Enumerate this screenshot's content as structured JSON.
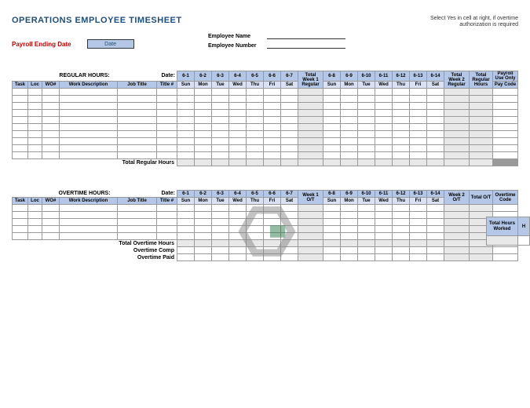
{
  "title": "OPERATIONS EMPLOYEE TIMESHEET",
  "note_line1": "Select Yes in cell at right, if overtime",
  "note_line2": "authorization is required",
  "ped_label": "Payroll Ending Date",
  "ped_value": "Date",
  "emp_name_label": "Employee Name",
  "emp_num_label": "Employee Number",
  "regular_title": "REGULAR HOURS:",
  "overtime_title": "OVERTIME HOURS:",
  "date_label": "Date:",
  "cols": {
    "task": "Task",
    "loc": "Loc",
    "wo": "WO#",
    "desc": "Work Description",
    "job": "Job Title",
    "titlenum": "Title #"
  },
  "days1": [
    "6-1",
    "6-2",
    "6-3",
    "6-4",
    "6-5",
    "6-6",
    "6-7"
  ],
  "days2": [
    "6-8",
    "6-9",
    "6-10",
    "6-11",
    "6-12",
    "6-13",
    "6-14"
  ],
  "dow": [
    "Sun",
    "Mon",
    "Tue",
    "Wed",
    "Thu",
    "Fri",
    "Sat"
  ],
  "totals": {
    "week1": "Total Week 1 Regular",
    "week2": "Total Week 2 Regular",
    "reghours": "Total Regular Hours",
    "payroll1": "Payroll Use Only",
    "payroll2": "Pay Code",
    "week1ot": "Week 1 O/T",
    "week2ot": "Week 2 O/T",
    "totalot": "Total O/T",
    "otcode": "Overtime Code"
  },
  "total_reg_label": "Total Regular Hours",
  "total_ot_label": "Total Overtime Hours",
  "ot_comp_label": "Overtime Comp",
  "ot_paid_label": "Overtime Paid",
  "footer": {
    "total_hours": "Total Hours Worked",
    "h": "H"
  }
}
